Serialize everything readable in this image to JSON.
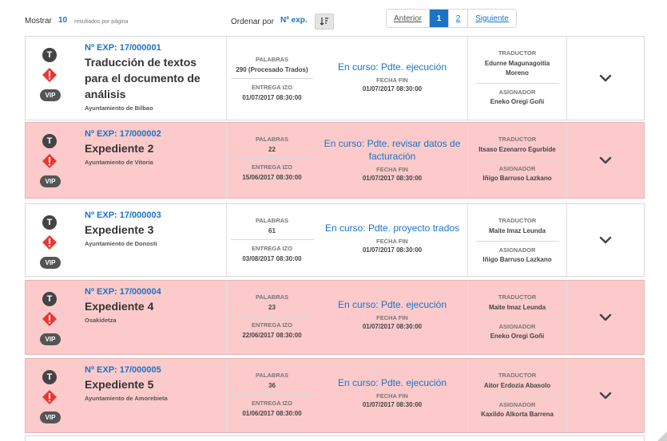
{
  "toolbar": {
    "show_label": "Mostrar",
    "show_count": "10",
    "per_page_label": "resultados por página",
    "order_label": "Ordenar por",
    "order_value": "Nº exp.",
    "sort_icon": "sort-icon"
  },
  "pagination": {
    "prev": "Anterior",
    "page1": "1",
    "page2": "2",
    "next": "Siguiente"
  },
  "labels": {
    "words": "PALABRAS",
    "delivery": "ENTREGA IZO",
    "end_date": "FECHA FIN",
    "translator": "TRADUCTOR",
    "assigner": "ASIGNADOR",
    "t_badge": "T",
    "vip_badge": "VIP"
  },
  "colors": {
    "accent": "#1a73c8",
    "alert": "#e53935",
    "pink_row": "#fccaca"
  },
  "expedientes": [
    {
      "number": "Nº EXP: 17/000001",
      "title": "Traducción de textos para el documento de análisis",
      "org": "Ayuntamiento de Bilbao",
      "words": "290 (Procesado Trados)",
      "delivery": "01/07/2017 08:30:00",
      "status": "En curso: Pdte. ejecución",
      "end_date": "01/07/2017 08:30:00",
      "translator": "Edurne Magunagoitia Moreno",
      "assigner": "Eneko Oregi Goñi",
      "highlight": false
    },
    {
      "number": "Nº EXP: 17/000002",
      "title": "Expediente 2",
      "org": "Ayuntamiento de Vitoria",
      "words": "22",
      "delivery": "15/06/2017 08:30:00",
      "status": "En curso: Pdte. revisar datos de facturación",
      "end_date": "01/07/2017 08:30:00",
      "translator": "Itsaso Ezenarro Egurbide",
      "assigner": "Iñigo Barruso Lazkano",
      "highlight": true
    },
    {
      "number": "Nº EXP: 17/000003",
      "title": "Expediente 3",
      "org": "Ayuntamiento de Donosti",
      "words": "61",
      "delivery": "03/08/2017 08:30:00",
      "status": "En curso: Pdte. proyecto trados",
      "end_date": "01/07/2017 08:30:00",
      "translator": "Maite Imaz Leunda",
      "assigner": "Iñigo Barruso Lazkano",
      "highlight": false
    },
    {
      "number": "Nº EXP: 17/000004",
      "title": "Expediente 4",
      "org": "Osakidetza",
      "words": "23",
      "delivery": "22/06/2017 08:30:00",
      "status": "En curso: Pdte. ejecución",
      "end_date": "01/07/2017 08:30:00",
      "translator": "Maite Imaz Leunda",
      "assigner": "Eneko Oregi Goñi",
      "highlight": true
    },
    {
      "number": "Nº EXP: 17/000005",
      "title": "Expediente 5",
      "org": "Ayuntamiento de Amorebieta",
      "words": "36",
      "delivery": "01/06/2017 08:30:00",
      "status": "En curso: Pdte. ejecución",
      "end_date": "01/07/2017 08:30:00",
      "translator": "Aitor Erdozia Abasolo",
      "assigner": "Kaxildo Alkorta Barrena",
      "highlight": true
    }
  ]
}
